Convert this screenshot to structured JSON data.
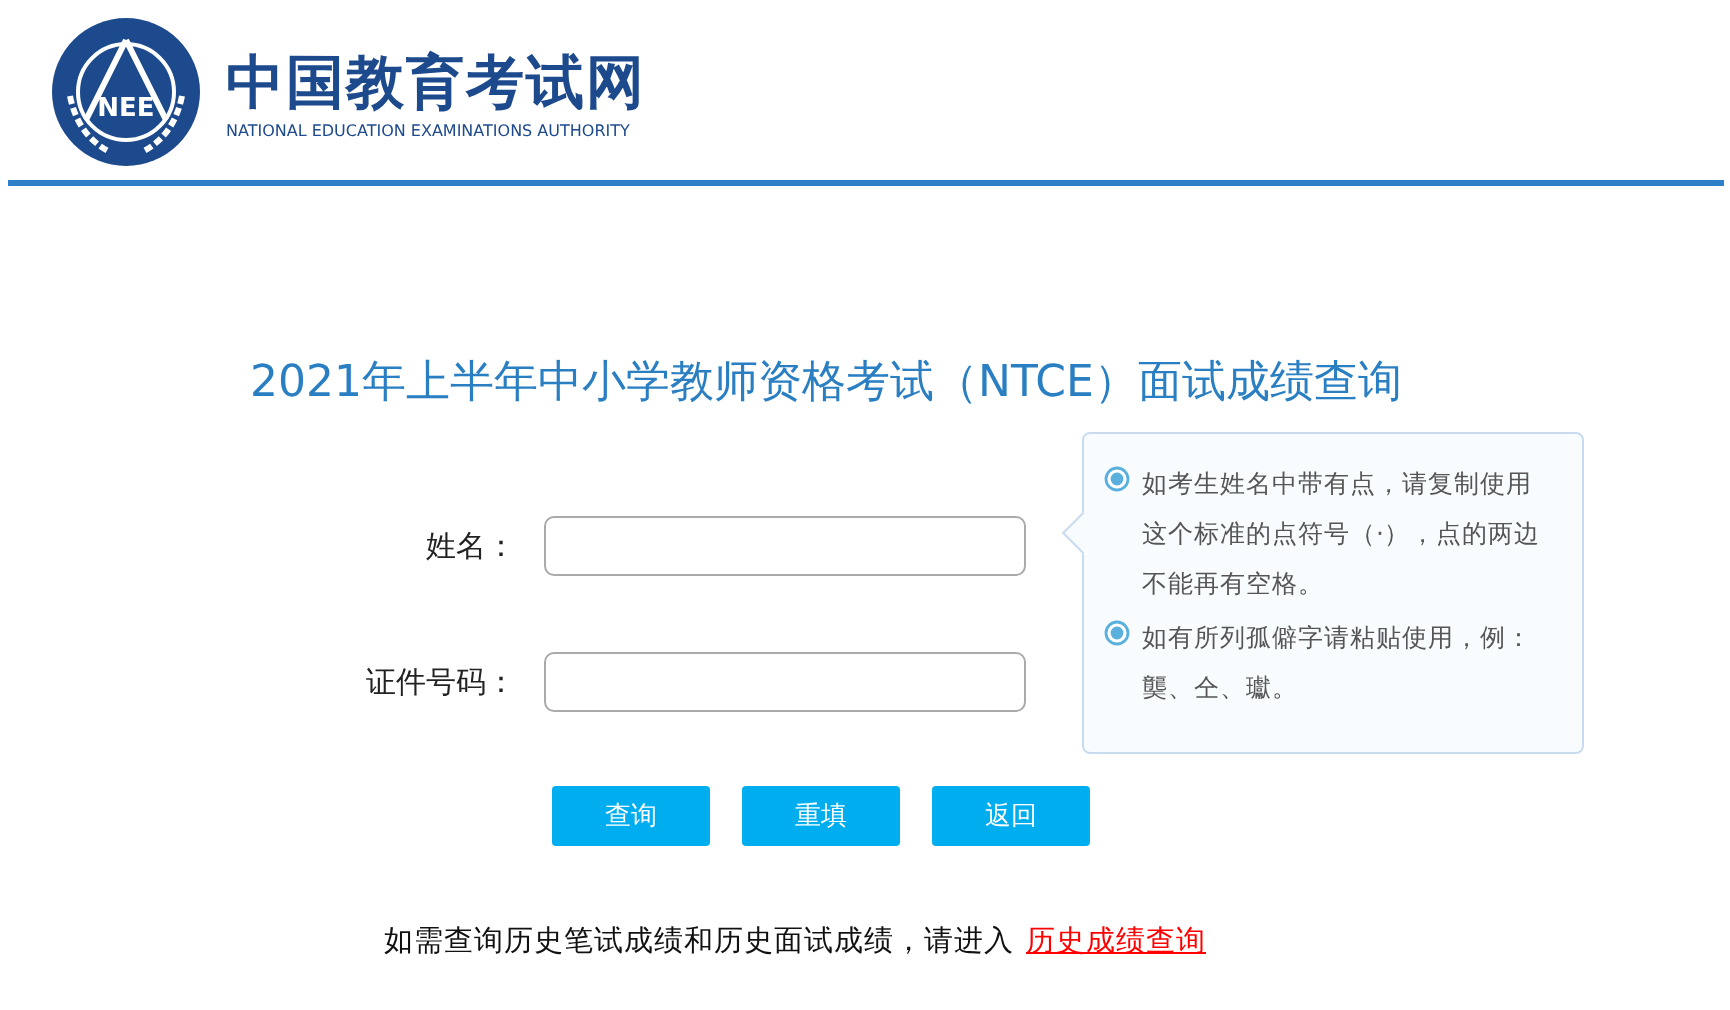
{
  "header": {
    "logo_letters": "NEE",
    "site_name": "中国教育考试网",
    "site_name_en": "NATIONAL EDUCATION EXAMINATIONS AUTHORITY"
  },
  "title": "2021年上半年中小学教师资格考试（NTCE）面试成绩查询",
  "fields": [
    {
      "label": "姓名："
    },
    {
      "label": "证件号码："
    }
  ],
  "tips": [
    "如考生姓名中带有点，请复制使用这个标准的点符号（·），点的两边不能再有空格。",
    "如有所列孤僻字请粘贴使用，例：龑、仝、瓛。"
  ],
  "buttons": [
    "查询",
    "重填",
    "返回"
  ],
  "footer": {
    "text": "如需查询历史笔试成绩和历史面试成绩，请进入",
    "link": "历史成绩查询"
  }
}
